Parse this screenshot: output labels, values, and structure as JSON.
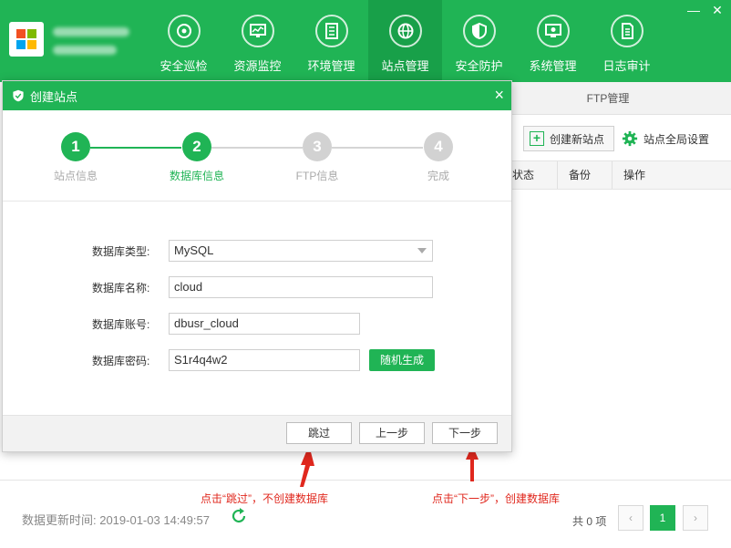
{
  "header": {
    "nav": [
      {
        "label": "安全巡检",
        "icon": "patrol-icon"
      },
      {
        "label": "资源监控",
        "icon": "monitor-icon"
      },
      {
        "label": "环境管理",
        "icon": "environment-icon"
      },
      {
        "label": "站点管理",
        "icon": "globe-icon",
        "active": true
      },
      {
        "label": "安全防护",
        "icon": "shield-icon"
      },
      {
        "label": "系统管理",
        "icon": "system-icon"
      },
      {
        "label": "日志审计",
        "icon": "log-icon"
      }
    ],
    "window_buttons": {
      "minimize": "—",
      "close": "✕"
    }
  },
  "background": {
    "tab_ftp": "FTP管理",
    "create_site": "创建新站点",
    "global_settings": "站点全局设置",
    "table_headers": [
      "状态",
      "备份",
      "操作"
    ],
    "update_time": "数据更新时间: 2019-01-03 14:49:57",
    "total": "共 0 项",
    "page": "1",
    "prev": "‹",
    "next": "›"
  },
  "modal": {
    "title": "创建站点",
    "close": "×",
    "steps": [
      {
        "num": "1",
        "label": "站点信息",
        "state": "done"
      },
      {
        "num": "2",
        "label": "数据库信息",
        "state": "active"
      },
      {
        "num": "3",
        "label": "FTP信息",
        "state": "todo"
      },
      {
        "num": "4",
        "label": "完成",
        "state": "todo"
      }
    ],
    "form": {
      "db_type_label": "数据库类型:",
      "db_type_value": "MySQL",
      "db_name_label": "数据库名称:",
      "db_name_value": "cloud",
      "db_user_label": "数据库账号:",
      "db_user_value": "dbusr_cloud",
      "db_pass_label": "数据库密码:",
      "db_pass_value": "S1r4q4w2",
      "generate_button": "随机生成"
    },
    "footer": {
      "skip": "跳过",
      "prev": "上一步",
      "next": "下一步"
    }
  },
  "annotations": {
    "skip_note": "点击“跳过”，不创建数据库",
    "next_note": "点击“下一步”，创建数据库"
  },
  "colors": {
    "accent": "#20b455",
    "annotation": "#e0281e"
  }
}
